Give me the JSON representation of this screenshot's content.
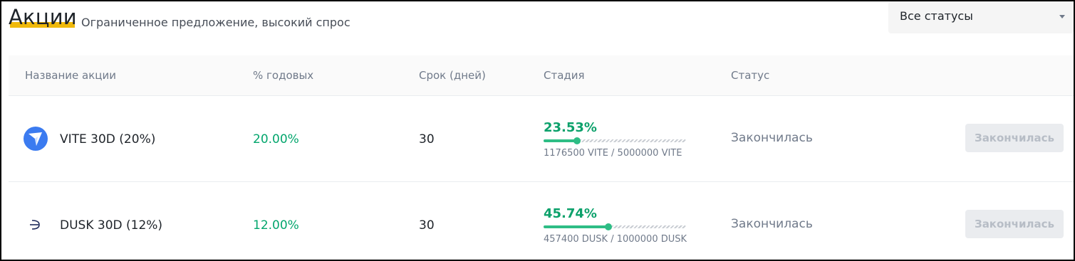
{
  "header": {
    "title": "Акции",
    "subtitle": "Ограниченное предложение, высокий спрос",
    "status_filter": "Все статусы"
  },
  "table": {
    "columns": [
      "Название акции",
      "% годовых",
      "Срок (дней)",
      "Стадия",
      "Статус"
    ],
    "rows": [
      {
        "name": "VITE 30D (20%)",
        "icon": "vite-icon",
        "apy": "20.00%",
        "term": "30",
        "stage_percent": "23.53%",
        "progress": 0.2353,
        "amounts": "1176500 VITE / 5000000 VITE",
        "status": "Закончилась",
        "button": "Закончилась"
      },
      {
        "name": "DUSK 30D (12%)",
        "icon": "dusk-icon",
        "apy": "12.00%",
        "term": "30",
        "stage_percent": "45.74%",
        "progress": 0.4574,
        "amounts": "457400 DUSK / 1000000 DUSK",
        "status": "Закончилась",
        "button": "Закончилась"
      }
    ]
  },
  "colors": {
    "accent": "#f0b90b",
    "green": "#2ebd85",
    "vite_blue": "#3b7bf0"
  }
}
